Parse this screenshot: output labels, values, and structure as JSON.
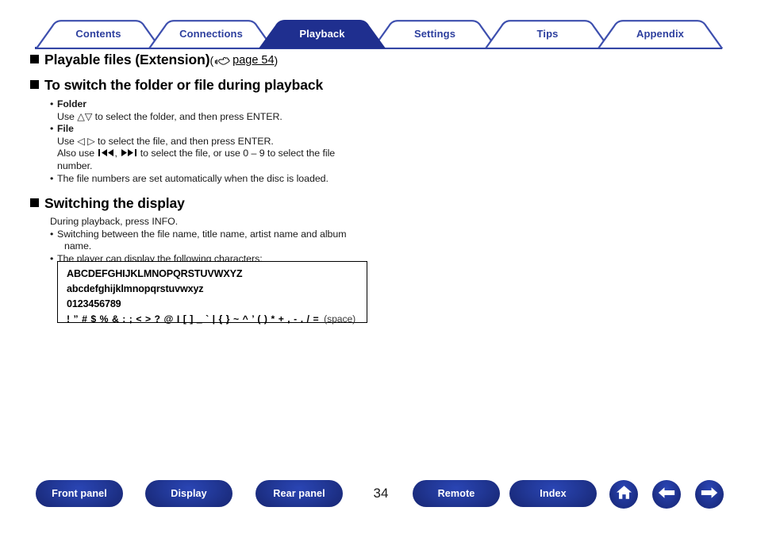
{
  "tabs": [
    {
      "label": "Contents",
      "active": false
    },
    {
      "label": "Connections",
      "active": false
    },
    {
      "label": "Playback",
      "active": true
    },
    {
      "label": "Settings",
      "active": false
    },
    {
      "label": "Tips",
      "active": false
    },
    {
      "label": "Appendix",
      "active": false
    }
  ],
  "colors": {
    "brand_blue": "#2d3f9e",
    "tab_active_bg": "#1f2f8f",
    "text": "#000000"
  },
  "sections": {
    "playable_files": {
      "heading": "Playable files (Extension)",
      "ref_open": "(",
      "ref_link": "page 54",
      "ref_close": ")",
      "ref_icon": "pointing-hand-icon"
    },
    "switch_folder": {
      "heading": "To switch the folder or file during playback",
      "items": [
        {
          "bullet": "•",
          "label": "Folder"
        },
        {
          "text": "Use △▽ to select the folder, and then press ENTER."
        },
        {
          "bullet": "•",
          "label": "File"
        },
        {
          "text": "Use ◁ ▷ to select the file, and then press ENTER."
        },
        {
          "text_pre": "Also use ",
          "icon_a": "skip-backward-icon",
          "text_mid": ", ",
          "icon_b": "skip-forward-icon",
          "text_post": " to select the file, or use 0 – 9 to select the file"
        },
        {
          "text": "number."
        },
        {
          "bullet": "•",
          "text": "The file numbers are set automatically when the disc is loaded."
        }
      ]
    },
    "switching_display": {
      "heading": "Switching the display",
      "intro": "During playback, press INFO.",
      "bullets": [
        "Switching between the file name, title name, artist name and album",
        "name.",
        "The player can display the following characters:"
      ],
      "charbox": {
        "uppercase": "ABCDEFGHIJKLMNOPQRSTUVWXYZ",
        "lowercase": "abcdefghijklmnopqrstuvwxyz",
        "digits": "0123456789",
        "symbols": "! ” # $ % & : ; < > ? @ I [ ] _ ` | { } ~ ^ ’ ( ) * + , - . / =",
        "space_note": "(space)"
      }
    }
  },
  "footer": {
    "buttons": [
      {
        "label": "Front panel",
        "name": "front-panel-button"
      },
      {
        "label": "Display",
        "name": "display-button"
      },
      {
        "label": "Rear panel",
        "name": "rear-panel-button"
      },
      {
        "label": "Remote",
        "name": "remote-button"
      },
      {
        "label": "Index",
        "name": "index-button"
      }
    ],
    "page_number": "34",
    "icons": [
      {
        "name": "home-icon"
      },
      {
        "name": "arrow-left-icon"
      },
      {
        "name": "arrow-right-icon"
      }
    ]
  }
}
